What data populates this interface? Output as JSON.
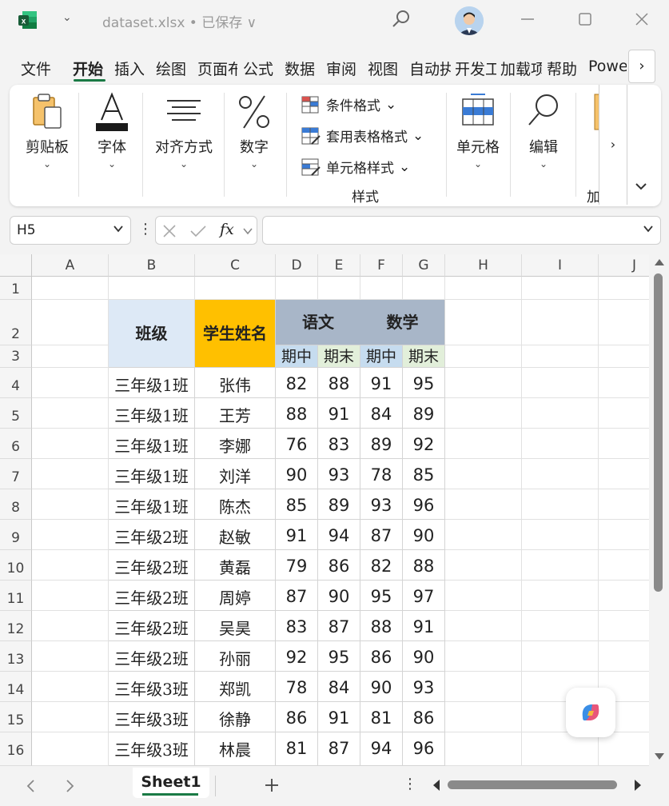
{
  "title_bar": {
    "doc_title": "dataset.xlsx • 已保存 ∨"
  },
  "ribbon_tabs": [
    "文件",
    "开始",
    "插入",
    "绘图",
    "页面布",
    "公式",
    "数据",
    "审阅",
    "视图",
    "自动执",
    "开发工",
    "加载项",
    "帮助",
    "Powe"
  ],
  "ribbon_tabs_active": "开始",
  "ribbon": {
    "clipboard": "剪贴板",
    "font": "字体",
    "alignment": "对齐方式",
    "number": "数字",
    "conditional_format": "条件格式",
    "format_as_table": "套用表格格式",
    "cell_styles": "单元格样式",
    "styles_group": "样式",
    "cells": "单元格",
    "editing": "编辑",
    "addins_partial": "加"
  },
  "formula_bar": {
    "name_box": "H5",
    "fx": "fx",
    "formula": ""
  },
  "sheet": {
    "columns": [
      "A",
      "B",
      "C",
      "D",
      "E",
      "F",
      "G",
      "H",
      "I",
      "J"
    ],
    "rows": [
      "1",
      "2",
      "3",
      "4",
      "5",
      "6",
      "7",
      "8",
      "9",
      "10",
      "11",
      "12",
      "13",
      "14",
      "15",
      "16"
    ],
    "header": {
      "class": "班级",
      "name": "学生姓名",
      "chinese": "语文",
      "math": "数学",
      "mid1": "期中",
      "end1": "期末",
      "mid2": "期中",
      "end2": "期末"
    },
    "data": [
      [
        "三年级1班",
        "张伟",
        "82",
        "88",
        "91",
        "95"
      ],
      [
        "三年级1班",
        "王芳",
        "88",
        "91",
        "84",
        "89"
      ],
      [
        "三年级1班",
        "李娜",
        "76",
        "83",
        "89",
        "92"
      ],
      [
        "三年级1班",
        "刘洋",
        "90",
        "93",
        "78",
        "85"
      ],
      [
        "三年级1班",
        "陈杰",
        "85",
        "89",
        "93",
        "96"
      ],
      [
        "三年级2班",
        "赵敏",
        "91",
        "94",
        "87",
        "90"
      ],
      [
        "三年级2班",
        "黄磊",
        "79",
        "86",
        "82",
        "88"
      ],
      [
        "三年级2班",
        "周婷",
        "87",
        "90",
        "95",
        "97"
      ],
      [
        "三年级2班",
        "吴昊",
        "83",
        "87",
        "88",
        "91"
      ],
      [
        "三年级2班",
        "孙丽",
        "92",
        "95",
        "86",
        "90"
      ],
      [
        "三年级3班",
        "郑凯",
        "78",
        "84",
        "90",
        "93"
      ],
      [
        "三年级3班",
        "徐静",
        "86",
        "91",
        "81",
        "86"
      ],
      [
        "三年级3班",
        "林晨",
        "81",
        "87",
        "94",
        "96"
      ]
    ]
  },
  "sheet_tab": "Sheet1",
  "colors": {
    "accent": "#1a7a45",
    "header_class_bg": "#dde9f6",
    "header_name_bg": "#ffc000",
    "header_subject_bg": "#a8b6c8",
    "mid_bg": "#c6dcef",
    "end_bg": "#e2efda"
  }
}
